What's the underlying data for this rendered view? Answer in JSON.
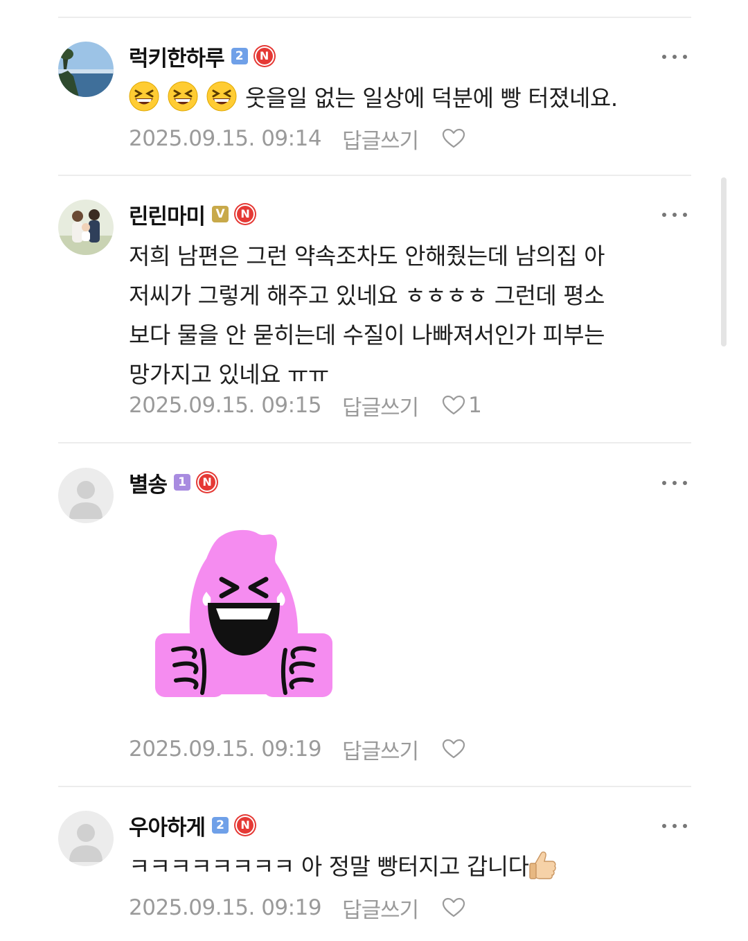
{
  "comments": [
    {
      "username": "럭키한하루",
      "level": "2",
      "text": "웃을일 없는 일상에 덕분에 빵 터졌네요.",
      "emoji_prefix": [
        "grinning-squinting-face",
        "grinning-squinting-face",
        "grinning-squinting-face"
      ],
      "date": "2025.09.15. 09:14",
      "reply_label": "답글쓰기",
      "likes": ""
    },
    {
      "username": "린린마미",
      "level": "V",
      "text_lines": [
        "저희 남편은 그런 약속조차도 안해줬는데 남의집 아",
        "저씨가 그렇게 해주고 있네요 ㅎㅎㅎㅎ 그런데 평소",
        "보다 물을 안 묻히는데 수질이 나빠져서인가 피부는",
        "망가지고 있네요 ㅠㅠ"
      ],
      "date": "2025.09.15. 09:15",
      "reply_label": "답글쓰기",
      "likes": "1"
    },
    {
      "username": "별송",
      "level": "1",
      "sticker": "pink-laughing-sticker",
      "date": "2025.09.15. 09:19",
      "reply_label": "답글쓰기",
      "likes": ""
    },
    {
      "username": "우아하게",
      "level": "2",
      "text": "ㅋㅋㅋㅋㅋㅋㅋㅋ 아 정말 빵터지고 갑니다",
      "emoji_suffix": "thumbs-up",
      "date": "2025.09.15. 09:19",
      "reply_label": "답글쓰기",
      "likes": ""
    }
  ],
  "badges": {
    "n_label": "N"
  },
  "colors": {
    "level1": "#a88be0",
    "level2": "#6fa0e8",
    "levelV": "#c8a94a",
    "n_badge": "#e53935",
    "meta_text": "#9a9a9a",
    "sticker_pink": "#f58cf0"
  }
}
